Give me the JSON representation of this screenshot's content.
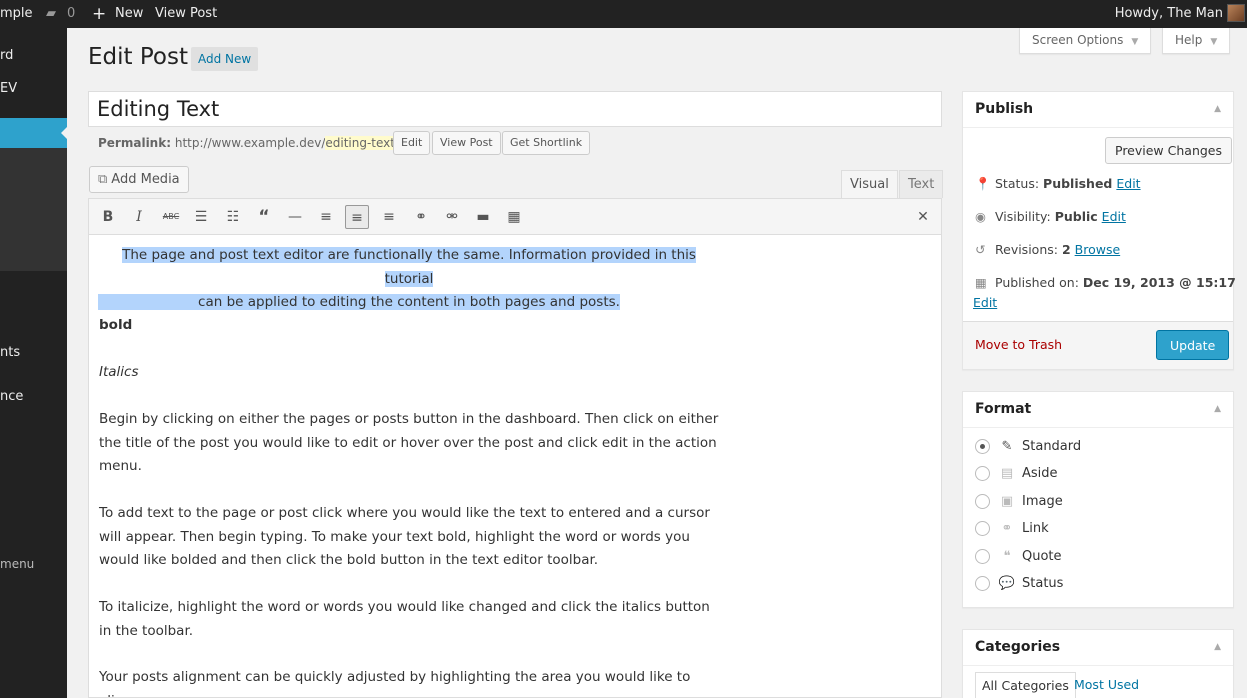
{
  "adminbar": {
    "site": "mple",
    "comments": "0",
    "new": "New",
    "view_post": "View Post",
    "howdy": "Howdy, The Man"
  },
  "adminmenu": {
    "items": [
      "rd",
      "EV",
      "nts",
      "nce",
      "menu"
    ]
  },
  "header": {
    "title": "Edit Post",
    "add_new": "Add New",
    "screen_options": "Screen Options",
    "help": "Help"
  },
  "post": {
    "title": "Editing Text",
    "permalink_label": "Permalink:",
    "permalink_base": "http://www.example.dev/",
    "permalink_slug": "editing-text",
    "permalink_trail": "/",
    "edit_btn": "Edit",
    "view_post_btn": "View Post",
    "shortlink_btn": "Get Shortlink"
  },
  "editor": {
    "add_media": "Add Media",
    "tab_visual": "Visual",
    "tab_text": "Text",
    "content": {
      "highlight_line1": "The page and post text editor are functionally the same. Information provided in this tutorial",
      "highlight_line2": "can be applied to editing the content in both pages and posts.",
      "bold": "bold",
      "italics": "Italics",
      "p1": "Begin by clicking on either the pages or posts button in the dashboard. Then click on either the title of the post you would like to edit or hover over the post and click edit in the action menu.",
      "p2": "To add text to the page or post click where you would like the text to entered and a cursor will appear. Then begin typing. To make your text bold, highlight the word or words you would like bolded and then click the bold button in the text editor toolbar.",
      "p3": "To italicize, highlight the word or words you would like changed and click the italics button in the toolbar.",
      "p4": "Your posts alignment can be quickly adjusted by highlighting the area you would like to align"
    }
  },
  "publish": {
    "title": "Publish",
    "preview": "Preview Changes",
    "status_label": "Status:",
    "status_value": "Published",
    "visibility_label": "Visibility:",
    "visibility_value": "Public",
    "revisions_label": "Revisions:",
    "revisions_value": "2",
    "browse": "Browse",
    "published_label": "Published on:",
    "published_value": "Dec 19, 2013 @ 15:17",
    "edit": "Edit",
    "trash": "Move to Trash",
    "update": "Update"
  },
  "format": {
    "title": "Format",
    "options": [
      "Standard",
      "Aside",
      "Image",
      "Link",
      "Quote",
      "Status"
    ]
  },
  "categories": {
    "title": "Categories",
    "tab_all": "All Categories",
    "tab_most": "Most Used"
  }
}
